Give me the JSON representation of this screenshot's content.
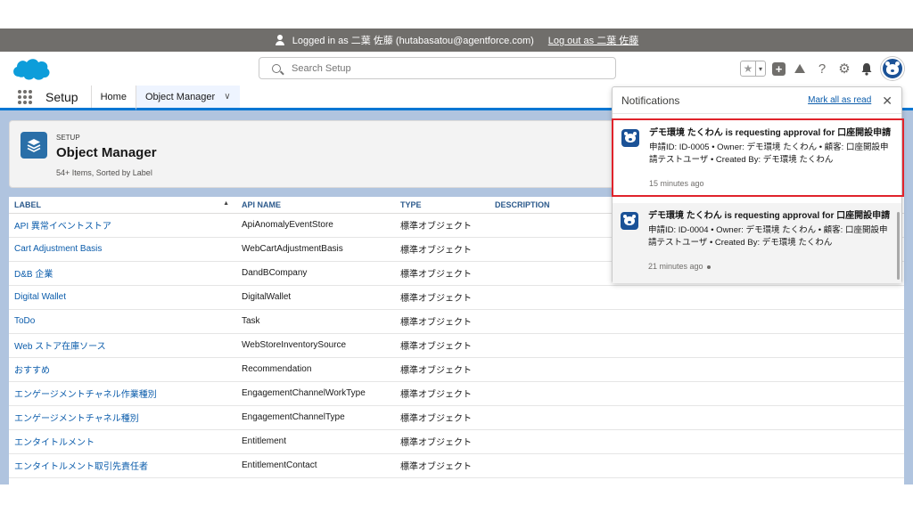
{
  "login_banner": {
    "text": "Logged in as 二葉 佐藤 (hutabasatou@agentforce.com)",
    "logout": "Log out as 二葉 佐藤"
  },
  "header": {
    "search_placeholder": "Search Setup",
    "icons": [
      "star-icon",
      "chevron-down-icon",
      "plus-icon",
      "trailhead-icon",
      "help-icon",
      "gear-icon",
      "bell-icon",
      "avatar"
    ]
  },
  "nav": {
    "app_name": "Setup",
    "tabs": [
      {
        "label": "Home"
      },
      {
        "label": "Object Manager"
      }
    ]
  },
  "object_manager": {
    "eyebrow": "SETUP",
    "title": "Object Manager",
    "subtitle": "54+ Items, Sorted by Label"
  },
  "table": {
    "headers": {
      "label": "LABEL",
      "api_name": "API NAME",
      "type": "TYPE",
      "description": "DESCRIPTION"
    },
    "rows": [
      {
        "label": "API 異常イベントストア",
        "api": "ApiAnomalyEventStore",
        "type": "標準オブジェクト"
      },
      {
        "label": "Cart Adjustment Basis",
        "api": "WebCartAdjustmentBasis",
        "type": "標準オブジェクト"
      },
      {
        "label": "D&B 企業",
        "api": "DandBCompany",
        "type": "標準オブジェクト"
      },
      {
        "label": "Digital Wallet",
        "api": "DigitalWallet",
        "type": "標準オブジェクト"
      },
      {
        "label": "ToDo",
        "api": "Task",
        "type": "標準オブジェクト"
      },
      {
        "label": "Web ストア在庫ソース",
        "api": "WebStoreInventorySource",
        "type": "標準オブジェクト"
      },
      {
        "label": "おすすめ",
        "api": "Recommendation",
        "type": "標準オブジェクト"
      },
      {
        "label": "エンゲージメントチャネル作業種別",
        "api": "EngagementChannelWorkType",
        "type": "標準オブジェクト"
      },
      {
        "label": "エンゲージメントチャネル種別",
        "api": "EngagementChannelType",
        "type": "標準オブジェクト"
      },
      {
        "label": "エンタイトルメント",
        "api": "Entitlement",
        "type": "標準オブジェクト"
      },
      {
        "label": "エンタイトルメント取引先責任者",
        "api": "EntitlementContact",
        "type": "標準オブジェクト"
      }
    ]
  },
  "notifications": {
    "title": "Notifications",
    "mark_all": "Mark all as read",
    "items": [
      {
        "title": "デモ環境 たくわん is requesting approval for 口座開設申請",
        "body": "申請ID: ID-0005 • Owner: デモ環境 たくわん • 顧客: 口座開設申請テストユーザ • Created By: デモ環境 たくわん",
        "time": "15 minutes ago"
      },
      {
        "title": "デモ環境 たくわん is requesting approval for 口座開設申請",
        "body": "申請ID: ID-0004 • Owner: デモ環境 たくわん • 顧客: 口座開設申請テストユーザ • Created By: デモ環境 たくわん",
        "time": "21 minutes ago"
      }
    ]
  }
}
